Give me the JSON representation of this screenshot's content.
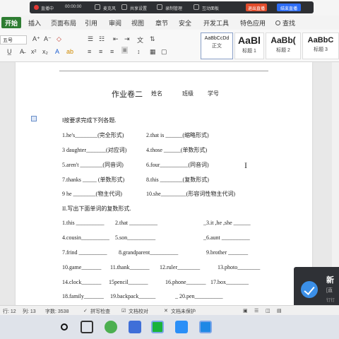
{
  "recording_bar": {
    "status": "直播中",
    "time": "00:00:00",
    "items": [
      "麦克风",
      "共享设置",
      "录制管理",
      "互动面板"
    ],
    "end_label": "退出直播",
    "share_label": "结束直播"
  },
  "tabs": {
    "items": [
      "开始",
      "插入",
      "页面布局",
      "引用",
      "审阅",
      "视图",
      "章节",
      "安全",
      "开发工具",
      "特色应用"
    ],
    "search_label": "查找"
  },
  "ribbon": {
    "font_name": "五号",
    "styles": [
      {
        "preview": "AaBbCcDd",
        "name": "正文"
      },
      {
        "preview": "AaBl",
        "name": "标题 1"
      },
      {
        "preview": "AaBb(",
        "name": "标题 2"
      },
      {
        "preview": "AaBbC",
        "name": "标题 3"
      }
    ]
  },
  "document": {
    "title": "作业卷二",
    "name_label": "姓名",
    "class_label": "班级",
    "id_label": "学号",
    "section1_heading": "Ⅰ按要求完成下列各题.",
    "section1_rows": [
      [
        "1.he's________(完全形式)",
        "2.that is ______(缩略形式)"
      ],
      [
        "3 daughter_______(对应词)",
        "4.those ______(单数形式)"
      ],
      [
        "5.aren't ________(同音词)",
        "6.four__________(同音词)"
      ],
      [
        "7.thanks _____ (单数形式)",
        "8.this ________(复数形式)"
      ],
      [
        "9 he ________(物主代词)",
        "10.she_________(形容词性物主代词)"
      ]
    ],
    "section2_heading": "II.写出下面单词的复数形式.",
    "section2_rows": [
      [
        "1.this __________",
        "2.that __________",
        "_3.it ,he ,she ______"
      ],
      [
        "4.cousin__________",
        "5.son__________",
        "_6.aunt __________"
      ],
      [
        "7.frind __________",
        "8.grandparent__________",
        "9.brother _______"
      ],
      [
        "10.game_______",
        "11.thank_______",
        "12.ruler________",
        "13.photo________"
      ],
      [
        "14.clock_______",
        "15pencil_______",
        "16.phone_______",
        "17.box________"
      ],
      [
        "18.family_______",
        "19.backpack______",
        "_ 20.pen__________"
      ]
    ]
  },
  "notification": {
    "title": "新",
    "line1": "[直",
    "line2": "钉钉"
  },
  "status_bar": {
    "row": "行: 12",
    "col": "列: 13",
    "words": "字数: 3538",
    "spellcheck": "拼写检查",
    "doc_check": "文档校对",
    "doc_unprotected": "文档未保护"
  },
  "colors": {
    "accent": "#2e7d32",
    "recording_bg": "#2d2f33",
    "taskbar_bg": "#dfe3ea"
  }
}
